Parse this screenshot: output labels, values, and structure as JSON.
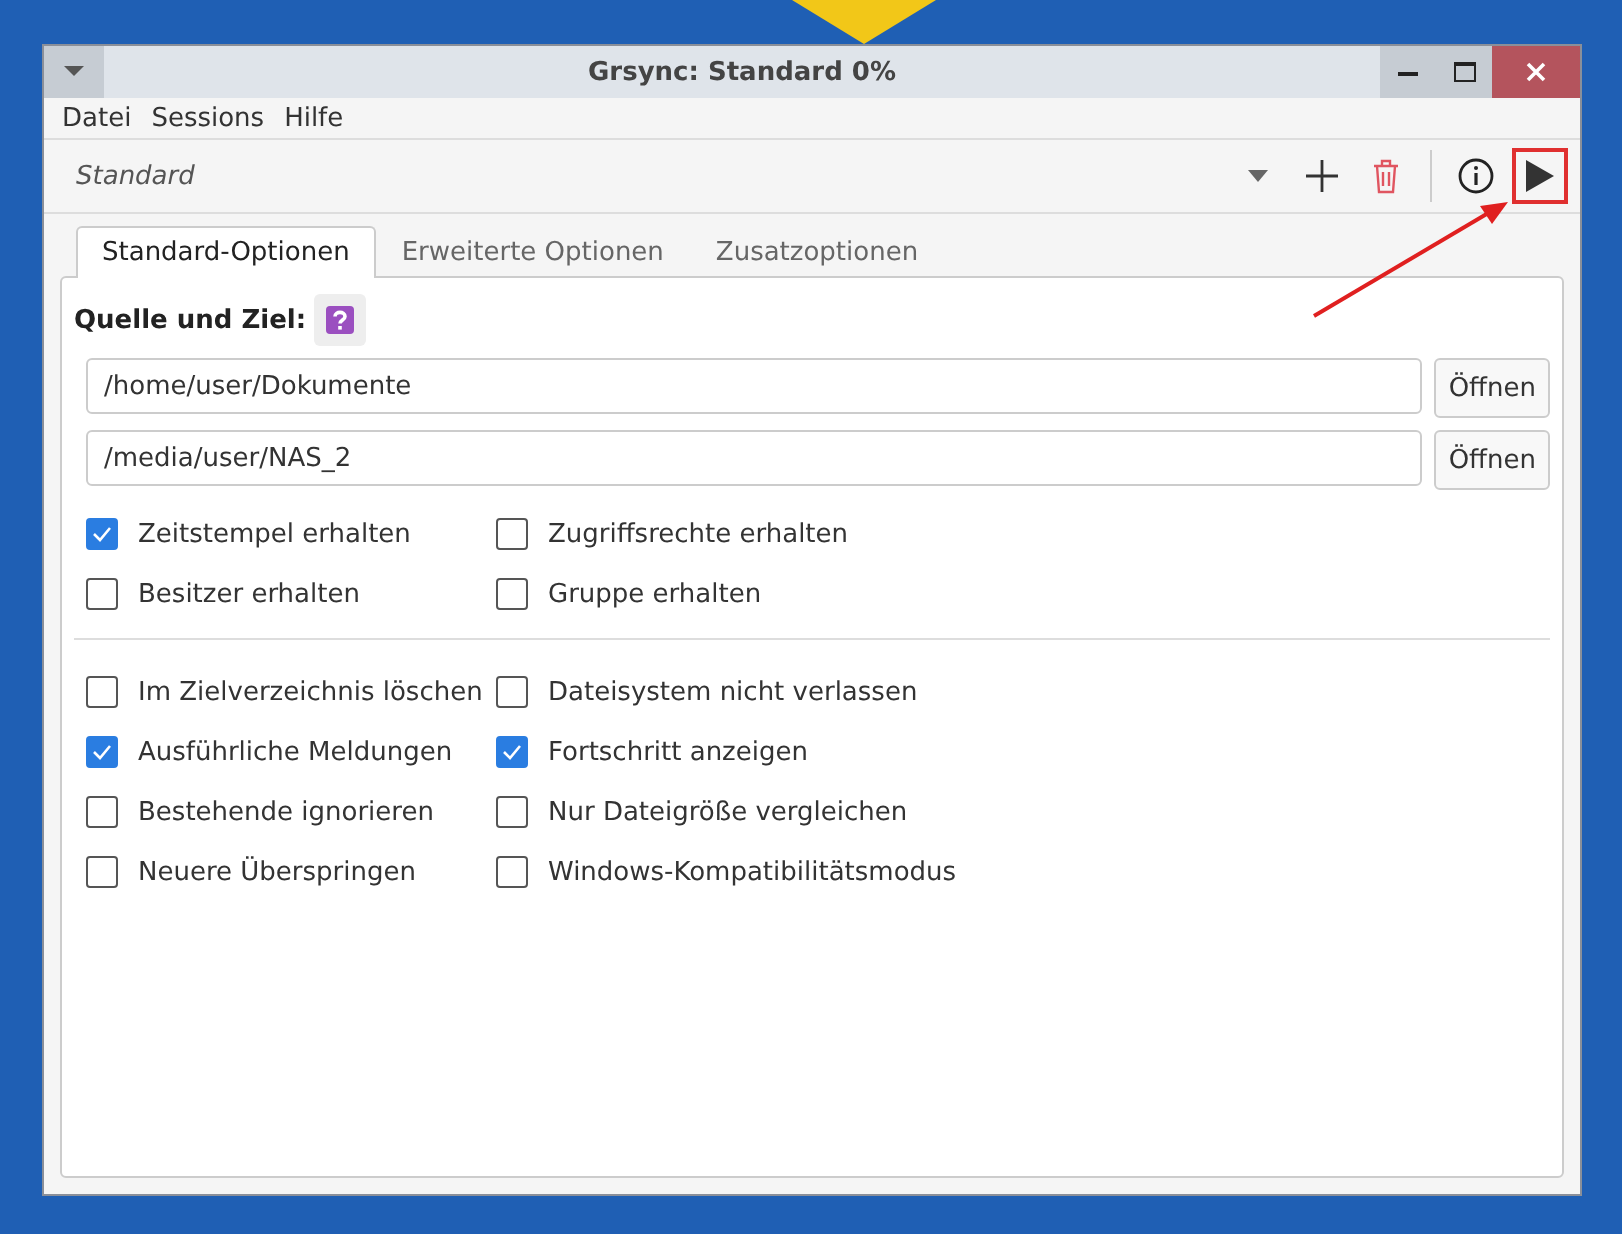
{
  "window": {
    "title": "Grsync: Standard 0%"
  },
  "menu": [
    "Datei",
    "Sessions",
    "Hilfe"
  ],
  "toolbar": {
    "session": "Standard",
    "play_highlighted": true
  },
  "tabs": [
    {
      "label": "Standard-Optionen",
      "selected": true
    },
    {
      "label": "Erweiterte Optionen",
      "selected": false
    },
    {
      "label": "Zusatzoptionen",
      "selected": false
    }
  ],
  "section_label": "Quelle und Ziel:",
  "paths": [
    {
      "value": "/home/user/Dokumente",
      "button": "Öffnen"
    },
    {
      "value": "/media/user/NAS_2",
      "button": "Öffnen"
    }
  ],
  "option_groups": [
    [
      {
        "label": "Zeitstempel erhalten",
        "checked": true
      },
      {
        "label": "Zugriffsrechte erhalten",
        "checked": false
      },
      {
        "label": "Besitzer erhalten",
        "checked": false
      },
      {
        "label": "Gruppe erhalten",
        "checked": false
      }
    ],
    [
      {
        "label": "Im Zielverzeichnis löschen",
        "checked": false
      },
      {
        "label": "Dateisystem nicht verlassen",
        "checked": false
      },
      {
        "label": "Ausführliche Meldungen",
        "checked": true
      },
      {
        "label": "Fortschritt anzeigen",
        "checked": true
      },
      {
        "label": "Bestehende ignorieren",
        "checked": false
      },
      {
        "label": "Nur Dateigröße vergleichen",
        "checked": false
      },
      {
        "label": "Neuere Überspringen",
        "checked": false
      },
      {
        "label": "Windows-Kompatibilitätsmodus",
        "checked": false
      }
    ]
  ]
}
